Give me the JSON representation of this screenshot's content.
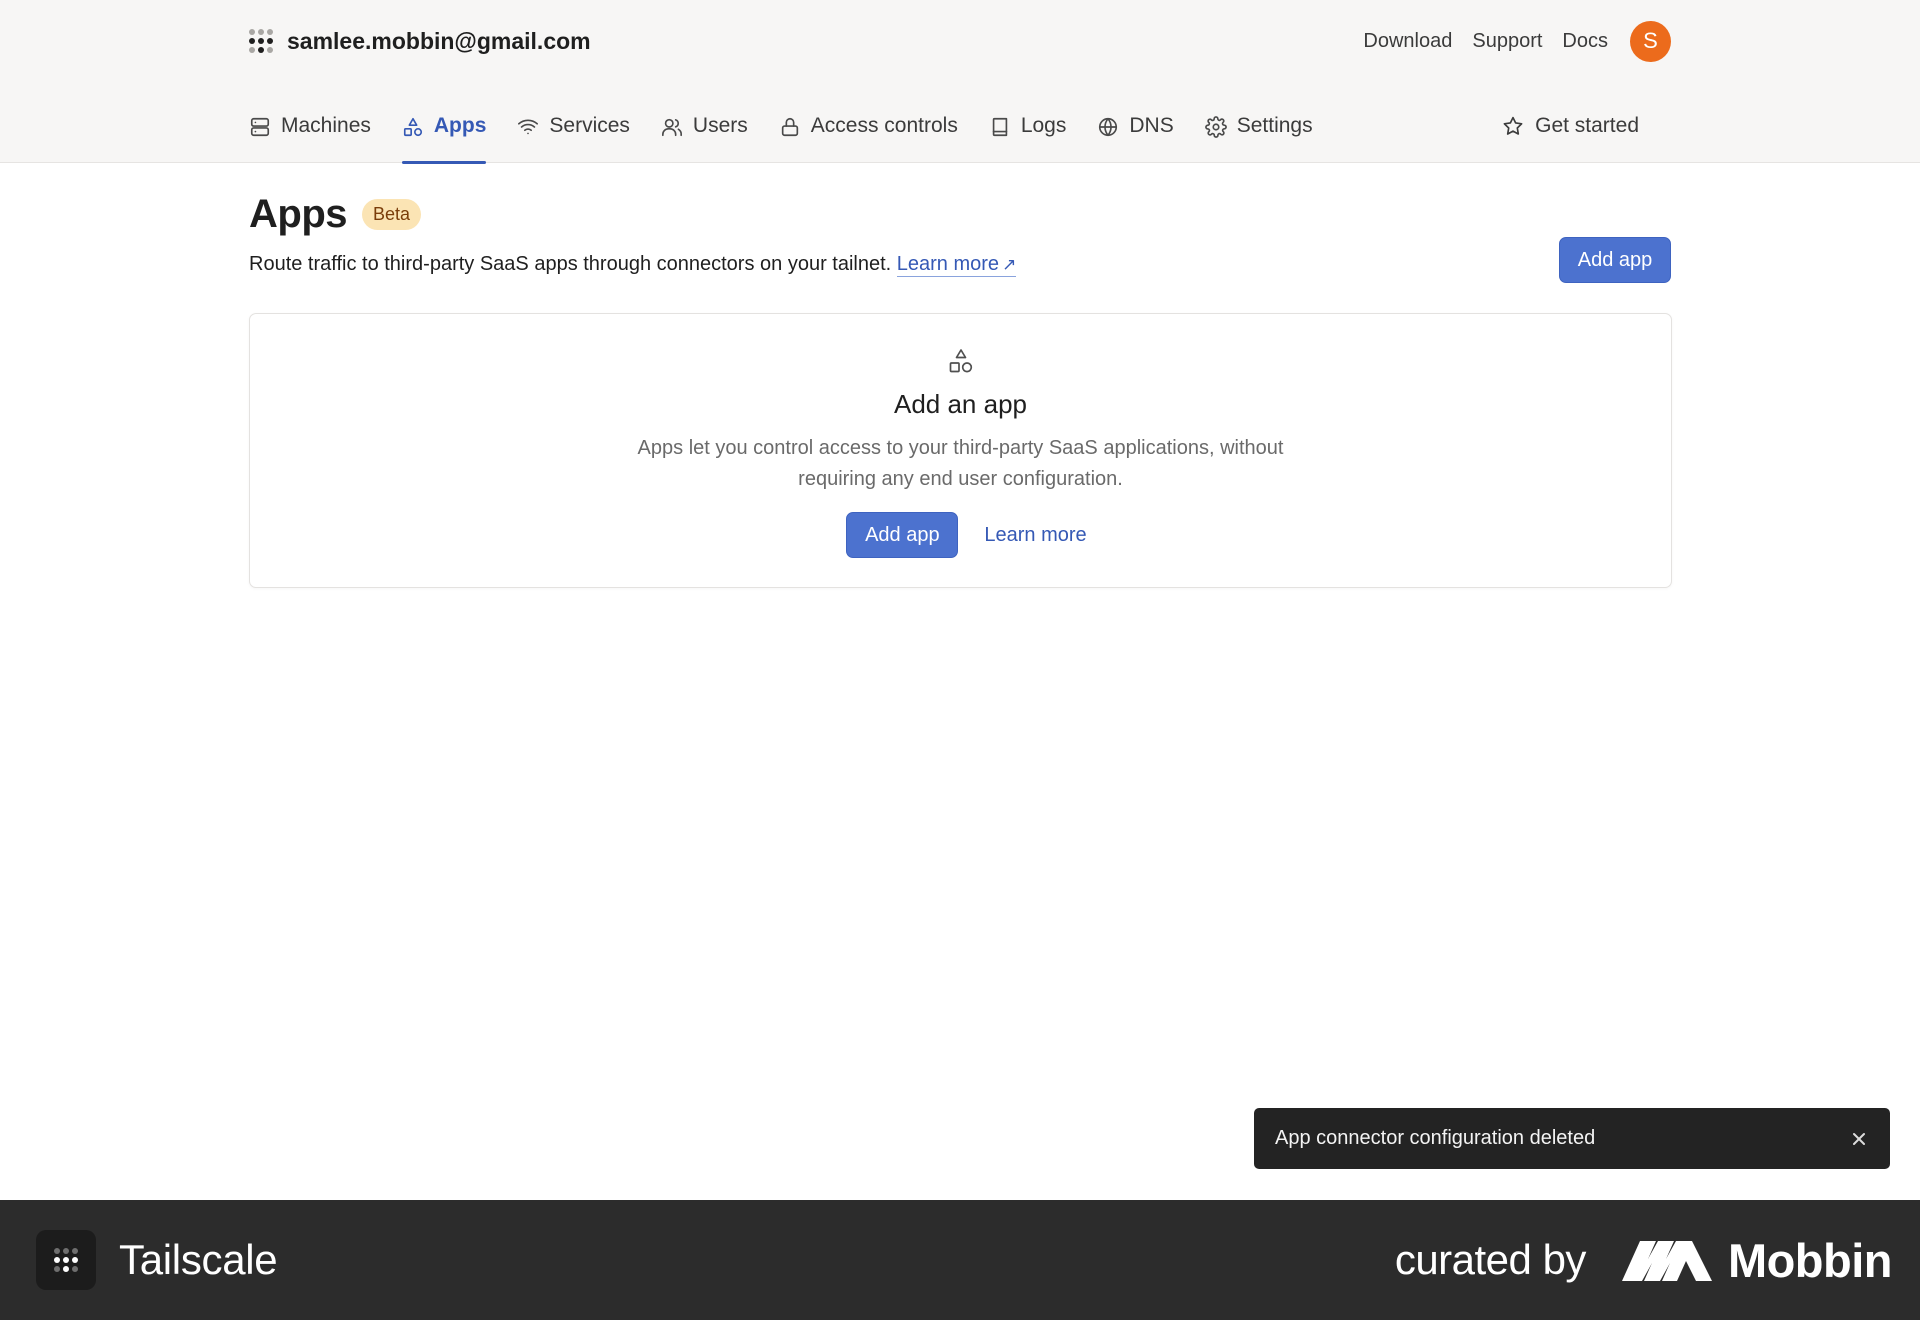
{
  "account": {
    "email": "samlee.mobbin@gmail.com"
  },
  "toplinks": [
    "Download",
    "Support",
    "Docs"
  ],
  "avatar": {
    "initial": "S",
    "color": "#ec6b1c"
  },
  "nav": {
    "items": [
      {
        "label": "Machines",
        "icon": "server-icon"
      },
      {
        "label": "Apps",
        "icon": "shapes-icon",
        "active": true
      },
      {
        "label": "Services",
        "icon": "wifi-icon"
      },
      {
        "label": "Users",
        "icon": "users-icon"
      },
      {
        "label": "Access controls",
        "icon": "lock-icon"
      },
      {
        "label": "Logs",
        "icon": "book-icon"
      },
      {
        "label": "DNS",
        "icon": "globe-icon"
      },
      {
        "label": "Settings",
        "icon": "gear-icon"
      }
    ],
    "get_started": "Get started"
  },
  "page": {
    "title": "Apps",
    "badge": "Beta",
    "subtitle": "Route traffic to third-party SaaS apps through connectors on your tailnet.",
    "learn_more": "Learn more",
    "add_app": "Add app"
  },
  "empty_state": {
    "title": "Add an app",
    "description": "Apps let you control access to your third-party SaaS applications, without requiring any end user configuration.",
    "add_app": "Add app",
    "learn_more": "Learn more"
  },
  "toast": {
    "message": "App connector configuration deleted"
  },
  "footer": {
    "brand": "Tailscale",
    "curated_by": "curated by",
    "curator": "Mobbin"
  },
  "colors": {
    "accent": "#3559b5",
    "primary_button": "#4c72cf",
    "badge_bg": "#fbe4b4",
    "footer_bg": "#2c2c2c",
    "toast_bg": "#232323"
  }
}
